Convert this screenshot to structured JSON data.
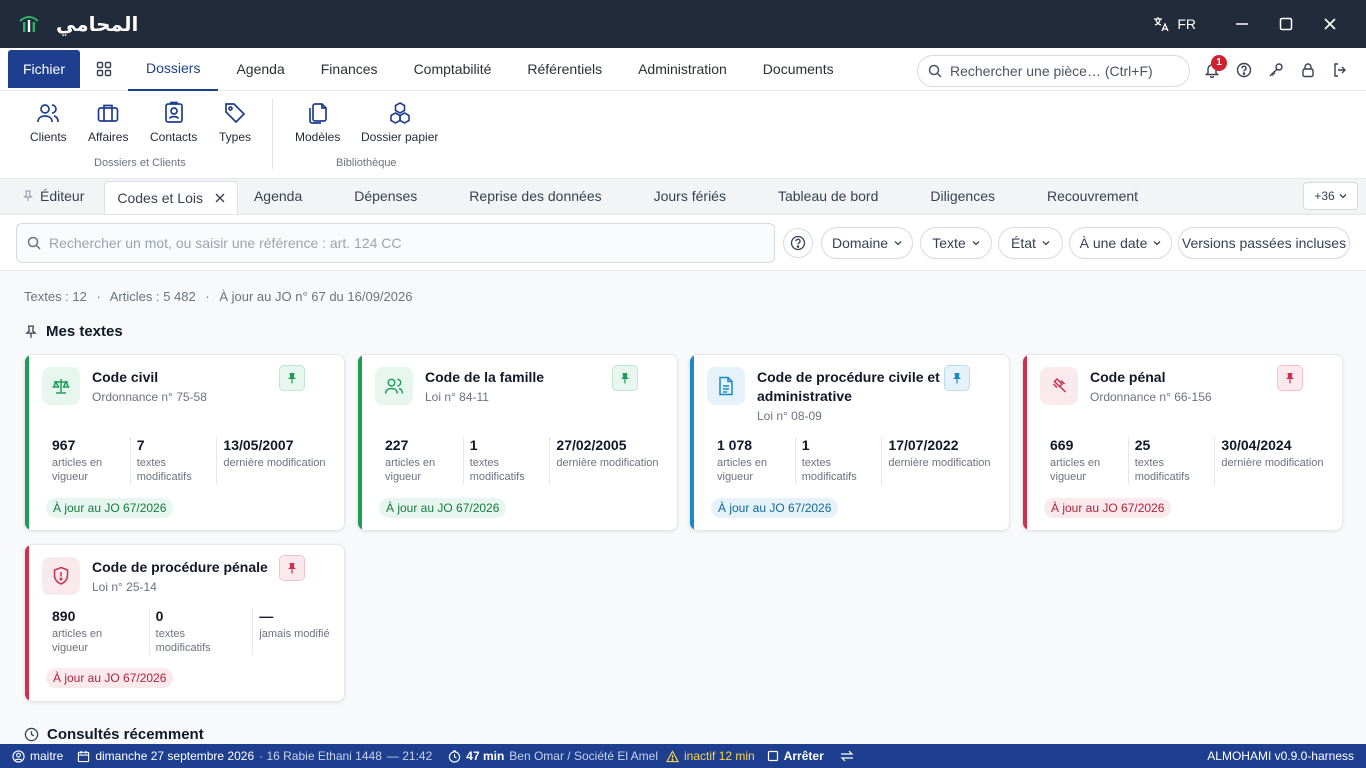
{
  "app": {
    "logo_text": "المحامي",
    "language": "FR"
  },
  "menu": {
    "fichier": "Fichier",
    "items": [
      "Dossiers",
      "Agenda",
      "Finances",
      "Comptabilité",
      "Référentiels",
      "Administration",
      "Documents"
    ],
    "search_placeholder": "Rechercher une pièce… (Ctrl+F)",
    "notification_count": "1"
  },
  "ribbon": {
    "buttons": [
      "Clients",
      "Affaires",
      "Contacts",
      "Types",
      "Modèles",
      "Dossier papier"
    ],
    "groups": [
      "Dossiers et Clients",
      "Bibliothèque"
    ]
  },
  "tabs": {
    "items": [
      "Éditeur",
      "Codes et Lois",
      "Agenda",
      "Dépenses",
      "Reprise des données",
      "Jours fériés",
      "Tableau de bord",
      "Diligences",
      "Recouvrement"
    ],
    "more": "+36"
  },
  "search": {
    "placeholder": "Rechercher un mot, ou saisir une référence : art. 124 CC",
    "filters": [
      "Domaine",
      "Texte",
      "État",
      "À une date",
      "Versions passées incluses"
    ]
  },
  "stats": {
    "textes": "Textes : 12",
    "articles": "Articles : 5 482",
    "jour": "À jour au JO n° 67 du 16/09/2026"
  },
  "sections": {
    "mes_textes": "Mes textes",
    "consultes": "Consultés récemment"
  },
  "cards": [
    {
      "title": "Code civil",
      "subtitle": "Ordonnance n° 75-58",
      "m1": "967",
      "m1l1": "articles en",
      "m1l2": "vigueur",
      "m2": "7",
      "m2l1": "textes",
      "m2l2": "modificatifs",
      "m3": "13/05/2007",
      "m3l1": "dernière modification",
      "status": "À jour au JO 67/2026",
      "color": "#1f9d57",
      "icon": "scale-icon"
    },
    {
      "title": "Code de la famille",
      "subtitle": "Loi n° 84-11",
      "m1": "227",
      "m1l1": "articles en",
      "m1l2": "vigueur",
      "m2": "1",
      "m2l1": "textes",
      "m2l2": "modificatifs",
      "m3": "27/02/2005",
      "m3l1": "dernière modification",
      "status": "À jour au JO 67/2026",
      "color": "#1f9d57",
      "icon": "users-icon"
    },
    {
      "title": "Code de procédure civile et administrative",
      "subtitle": "Loi n° 08-09",
      "m1": "1 078",
      "m1l1": "articles en",
      "m1l2": "vigueur",
      "m2": "1",
      "m2l1": "textes",
      "m2l2": "modificatifs",
      "m3": "17/07/2022",
      "m3l1": "dernière modification",
      "status": "À jour au JO 67/2026",
      "color": "#1a8ac7",
      "icon": "document-icon"
    },
    {
      "title": "Code pénal",
      "subtitle": "Ordonnance n° 66-156",
      "m1": "669",
      "m1l1": "articles en",
      "m1l2": "vigueur",
      "m2": "25",
      "m2l1": "textes",
      "m2l2": "modificatifs",
      "m3": "30/04/2024",
      "m3l1": "dernière modification",
      "status": "À jour au JO 67/2026",
      "color": "#d0304c",
      "icon": "gavel-icon"
    },
    {
      "title": "Code de procédure pénale",
      "subtitle": "Loi n° 25-14",
      "m1": "890",
      "m1l1": "articles en",
      "m1l2": "vigueur",
      "m2": "0",
      "m2l1": "textes",
      "m2l2": "modificatifs",
      "m3": "—",
      "m3l1": "jamais modifié",
      "status": "À jour au JO 67/2026",
      "color": "#d0304c",
      "icon": "shield-alert-icon"
    }
  ],
  "statusbar": {
    "user": "maitre",
    "date": "dimanche 27 septembre 2026",
    "hijri": "· 16 Rabie Ethani 1448",
    "time": "— 21:42",
    "timer": "47 min",
    "client": "Ben Omar / Société El Amel",
    "inactive": "inactif 12 min",
    "stop": "Arrêter",
    "version": "ALMOHAMI v0.9.0-harness"
  }
}
